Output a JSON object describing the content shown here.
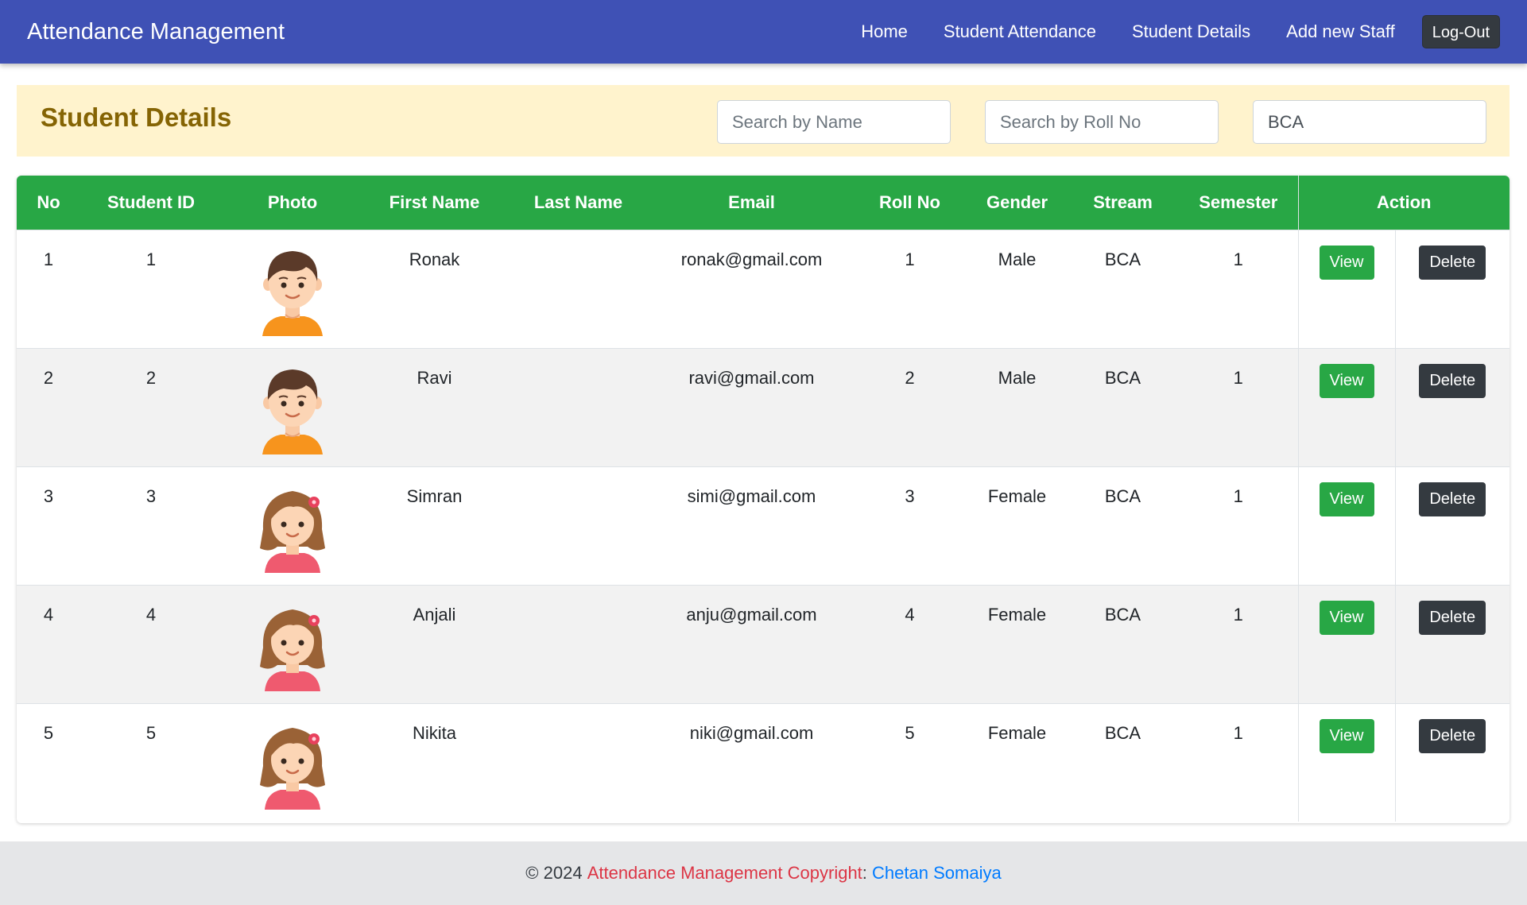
{
  "navbar": {
    "brand": "Attendance Management",
    "links": [
      "Home",
      "Student Attendance",
      "Student Details",
      "Add new Staff"
    ],
    "logout_label": "Log-Out"
  },
  "header": {
    "title": "Student Details",
    "search_name_placeholder": "Search by Name",
    "search_roll_placeholder": "Search by Roll No",
    "stream_filter_value": "BCA"
  },
  "table": {
    "columns": [
      "No",
      "Student ID",
      "Photo",
      "First Name",
      "Last Name",
      "Email",
      "Roll No",
      "Gender",
      "Stream",
      "Semester",
      "Action"
    ],
    "view_label": "View",
    "delete_label": "Delete",
    "rows": [
      {
        "no": "1",
        "student_id": "1",
        "photo": "boy-avatar",
        "first_name": "Ronak",
        "last_name": "",
        "email": "ronak@gmail.com",
        "roll_no": "1",
        "gender": "Male",
        "stream": "BCA",
        "semester": "1"
      },
      {
        "no": "2",
        "student_id": "2",
        "photo": "boy-avatar",
        "first_name": "Ravi",
        "last_name": "",
        "email": "ravi@gmail.com",
        "roll_no": "2",
        "gender": "Male",
        "stream": "BCA",
        "semester": "1"
      },
      {
        "no": "3",
        "student_id": "3",
        "photo": "girl-avatar",
        "first_name": "Simran",
        "last_name": "",
        "email": "simi@gmail.com",
        "roll_no": "3",
        "gender": "Female",
        "stream": "BCA",
        "semester": "1"
      },
      {
        "no": "4",
        "student_id": "4",
        "photo": "girl-avatar",
        "first_name": "Anjali",
        "last_name": "",
        "email": "anju@gmail.com",
        "roll_no": "4",
        "gender": "Female",
        "stream": "BCA",
        "semester": "1"
      },
      {
        "no": "5",
        "student_id": "5",
        "photo": "girl-avatar",
        "first_name": "Nikita",
        "last_name": "",
        "email": "niki@gmail.com",
        "roll_no": "5",
        "gender": "Female",
        "stream": "BCA",
        "semester": "1"
      }
    ]
  },
  "footer": {
    "copyright": "© 2024",
    "app_text": "Attendance Management Copyright",
    "separator": ":",
    "author": "Chetan Somaiya"
  },
  "colors": {
    "navbar": "#3f51b5",
    "table_header": "#28a745",
    "header_bar": "#fff3cd",
    "title": "#856404",
    "delete_button": "#343a40",
    "footer_red": "#dc3545",
    "footer_blue": "#007bff"
  }
}
